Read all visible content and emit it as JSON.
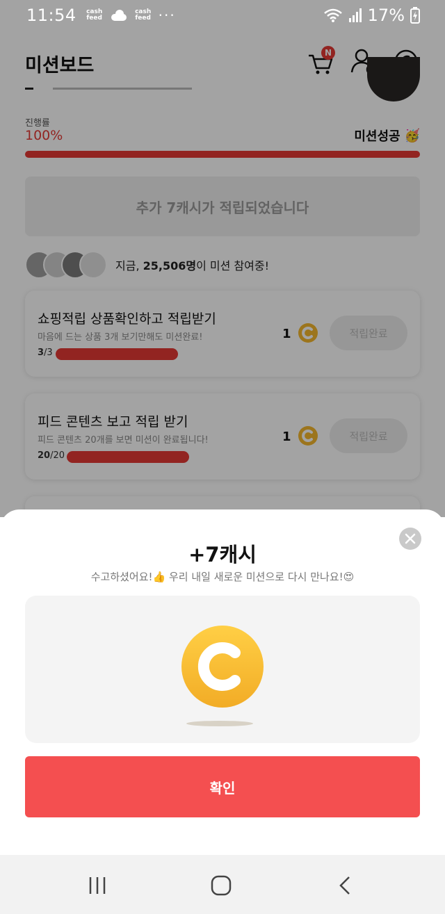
{
  "status_bar": {
    "time": "11:54",
    "notif_app_1": "cash feed",
    "notif_app_2": "cash feed",
    "more_dots": "···",
    "battery": "17%"
  },
  "app": {
    "title": "미션보드",
    "cart_badge": "N",
    "progress_label": "진행률",
    "progress_percent": "100%",
    "progress_value": 1.0,
    "mission_status": "미션성공",
    "mission_status_emoji": "🥳",
    "notice": "추가 7캐시가 적립되었습니다",
    "participants": {
      "prefix": "지금, ",
      "count": "25,506명",
      "suffix": "이 미션 참여중!"
    },
    "missions": [
      {
        "title": "쇼핑적립 상품확인하고 적립받기",
        "subtitle": "마음에 드는 상품 3개 보기만해도 미션완료!",
        "done": "3",
        "total": "/3",
        "reward": "1",
        "button": "적립완료"
      },
      {
        "title": "피드 콘텐츠 보고 적립 받기",
        "subtitle": "피드 콘텐츠 20개를 보면 미션이 완료됩니다!",
        "done": "20",
        "total": "/20",
        "reward": "1",
        "button": "적립완료"
      }
    ]
  },
  "sheet": {
    "title": "+7캐시",
    "subtitle": "수고하셨어요!👍 우리 내일 새로운 미션으로 다시 만나요!😍",
    "confirm": "확인"
  },
  "colors": {
    "accent_red": "#e53935",
    "confirm_red": "#f44f50",
    "coin_yellow": "#f5b82e"
  }
}
